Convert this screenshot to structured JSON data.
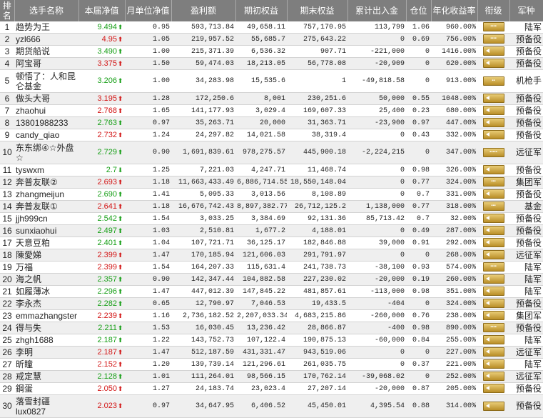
{
  "headers": [
    "排名",
    "选手名称",
    "本届净值",
    "月单位净值",
    "盈利额",
    "期初权益",
    "期末权益",
    "累计出入金",
    "仓位",
    "年化收益率",
    "衔级",
    "军种"
  ],
  "colors": {
    "header_bg": "#7e7e7e",
    "up": "#19a019",
    "down": "#d31818",
    "badge_gold": "#c99e33"
  },
  "rows": [
    {
      "rank": "1",
      "name": "趋势为王",
      "nav": "9.494",
      "dir": "up",
      "arrow": "⬆",
      "month": "0.95",
      "profit": "593,713.84",
      "start": "49,658.11",
      "end": "757,170.95",
      "flow": "113,799",
      "pos": "1.06",
      "annual": "960.00%",
      "badge": "▪▪▪▪",
      "type": "陆军"
    },
    {
      "rank": "2",
      "name": "yzl666",
      "nav": "4.95",
      "dir": "down",
      "arrow": "⬆",
      "month": "1.05",
      "profit": "219,957.52",
      "start": "55,685.7",
      "end": "275,643.22",
      "flow": "0",
      "pos": "0.69",
      "annual": "756.00%",
      "badge": "▪▪▪▪",
      "type": "预备役"
    },
    {
      "rank": "3",
      "name": "期货船说",
      "nav": "3.490",
      "dir": "up",
      "arrow": "⬆",
      "month": "1.00",
      "profit": "215,371.39",
      "start": "6,536.32",
      "end": "907.71",
      "flow": "-221,000",
      "pos": "0",
      "annual": "1416.00%",
      "badge": "",
      "type": "预备役"
    },
    {
      "rank": "4",
      "name": "阿宝哥",
      "nav": "3.375",
      "dir": "down",
      "arrow": "⬆",
      "month": "1.50",
      "profit": "59,474.03",
      "start": "18,213.05",
      "end": "56,778.08",
      "flow": "-20,909",
      "pos": "0",
      "annual": "620.00%",
      "badge": "",
      "type": "预备役"
    },
    {
      "rank": "5",
      "name": "顿悟了：人和昆仑基金",
      "nav": "3.206",
      "dir": "up",
      "arrow": "⬆",
      "month": "1.00",
      "profit": "34,283.98",
      "start": "15,535.6",
      "end": "1",
      "flow": "-49,818.58",
      "pos": "0",
      "annual": "913.00%",
      "badge": "▪▪",
      "type": "机枪手",
      "tall": true
    },
    {
      "rank": "6",
      "name": "做头大哥",
      "nav": "3.195",
      "dir": "down",
      "arrow": "⬆",
      "month": "1.28",
      "profit": "172,250.6",
      "start": "8,001",
      "end": "230,251.6",
      "flow": "50,000",
      "pos": "0.55",
      "annual": "1048.00%",
      "badge": "",
      "type": "预备役"
    },
    {
      "rank": "7",
      "name": "zhaohui",
      "nav": "2.768",
      "dir": "down",
      "arrow": "⬆",
      "month": "1.65",
      "profit": "141,177.93",
      "start": "3,029.4",
      "end": "169,607.33",
      "flow": "25,400",
      "pos": "0.23",
      "annual": "680.00%",
      "badge": "",
      "type": "预备役"
    },
    {
      "rank": "8",
      "name": "13801988233",
      "nav": "2.763",
      "dir": "up",
      "arrow": "⬆",
      "month": "0.97",
      "profit": "35,263.71",
      "start": "20,000",
      "end": "31,363.71",
      "flow": "-23,900",
      "pos": "0.97",
      "annual": "447.00%",
      "badge": "",
      "type": "预备役"
    },
    {
      "rank": "9",
      "name": "candy_qiao",
      "nav": "2.732",
      "dir": "down",
      "arrow": "⬆",
      "month": "1.24",
      "profit": "24,297.82",
      "start": "14,021.58",
      "end": "38,319.4",
      "flow": "0",
      "pos": "0.43",
      "annual": "332.00%",
      "badge": "",
      "type": "预备役"
    },
    {
      "rank": "10",
      "name": "东东绑④☆外盘☆",
      "nav": "2.729",
      "dir": "up",
      "arrow": "⬆",
      "month": "0.90",
      "profit": "1,691,839.61",
      "start": "978,275.57",
      "end": "445,900.18",
      "flow": "-2,224,215",
      "pos": "0",
      "annual": "347.00%",
      "badge": "▪▪▪▪▪",
      "type": "远征军",
      "tall": true
    },
    {
      "rank": "11",
      "name": "tyswxm",
      "nav": "2.7",
      "dir": "up",
      "arrow": "⬇",
      "month": "1.25",
      "profit": "7,221.03",
      "start": "4,247.71",
      "end": "11,468.74",
      "flow": "0",
      "pos": "0.98",
      "annual": "326.00%",
      "badge": "",
      "type": "预备役"
    },
    {
      "rank": "12",
      "name": "奔普友联②",
      "nav": "2.693",
      "dir": "down",
      "arrow": "⬆",
      "month": "1.18",
      "profit": "11,663,433.49",
      "start": "6,886,714.55",
      "end": "18,550,148.04",
      "flow": "0",
      "pos": "0.77",
      "annual": "324.00%",
      "badge": "▪▪▪",
      "type": "集团军"
    },
    {
      "rank": "13",
      "name": "zhangmeijun",
      "nav": "2.690",
      "dir": "up",
      "arrow": "⬆",
      "month": "1.41",
      "profit": "5,095.33",
      "start": "3,013.56",
      "end": "8,108.89",
      "flow": "0",
      "pos": "0.7",
      "annual": "331.00%",
      "badge": "",
      "type": "预备役"
    },
    {
      "rank": "14",
      "name": "奔普友联①",
      "nav": "2.641",
      "dir": "down",
      "arrow": "⬆",
      "month": "1.18",
      "profit": "16,676,742.43",
      "start": "8,897,382.77",
      "end": "26,712,125.2",
      "flow": "1,138,000",
      "pos": "0.77",
      "annual": "318.00%",
      "badge": "▪▪▪",
      "type": "基金"
    },
    {
      "rank": "15",
      "name": "jjh999cn",
      "nav": "2.542",
      "dir": "up",
      "arrow": "⬆",
      "month": "1.54",
      "profit": "3,033.25",
      "start": "3,384.69",
      "end": "92,131.36",
      "flow": "85,713.42",
      "pos": "0.7",
      "annual": "32.00%",
      "badge": "",
      "type": "预备役"
    },
    {
      "rank": "16",
      "name": "sunxiaohui",
      "nav": "2.497",
      "dir": "up",
      "arrow": "⬆",
      "month": "1.03",
      "profit": "2,510.81",
      "start": "1,677.2",
      "end": "4,188.01",
      "flow": "0",
      "pos": "0.49",
      "annual": "287.00%",
      "badge": "",
      "type": "预备役"
    },
    {
      "rank": "17",
      "name": "天意豆粕",
      "nav": "2.401",
      "dir": "up",
      "arrow": "⬆",
      "month": "1.04",
      "profit": "107,721.71",
      "start": "36,125.17",
      "end": "182,846.88",
      "flow": "39,000",
      "pos": "0.91",
      "annual": "292.00%",
      "badge": "",
      "type": "预备役"
    },
    {
      "rank": "18",
      "name": "陳愛娣",
      "nav": "2.399",
      "dir": "down",
      "arrow": "⬆",
      "month": "1.47",
      "profit": "170,185.94",
      "start": "121,606.03",
      "end": "291,791.97",
      "flow": "0",
      "pos": "0",
      "annual": "268.00%",
      "badge": "",
      "type": "远征军"
    },
    {
      "rank": "19",
      "name": "万福",
      "nav": "2.399",
      "dir": "down",
      "arrow": "⬆",
      "month": "1.54",
      "profit": "164,207.33",
      "start": "115,631.4",
      "end": "241,738.73",
      "flow": "-38,100",
      "pos": "0.93",
      "annual": "574.00%",
      "badge": "▪▪▪▪",
      "type": "陆军"
    },
    {
      "rank": "20",
      "name": "海之帆",
      "nav": "2.357",
      "dir": "up",
      "arrow": "⬆",
      "month": "0.90",
      "profit": "142,347.44",
      "start": "104,882.58",
      "end": "227,230.02",
      "flow": "-20,000",
      "pos": "0.19",
      "annual": "260.00%",
      "badge": "",
      "type": "陆军"
    },
    {
      "rank": "21",
      "name": "如履薄冰",
      "nav": "2.296",
      "dir": "up",
      "arrow": "⬆",
      "month": "1.47",
      "profit": "447,012.39",
      "start": "147,845.22",
      "end": "481,857.61",
      "flow": "-113,000",
      "pos": "0.98",
      "annual": "351.00%",
      "badge": "",
      "type": "陆军"
    },
    {
      "rank": "22",
      "name": "李永杰",
      "nav": "2.282",
      "dir": "up",
      "arrow": "⬆",
      "month": "0.65",
      "profit": "12,790.97",
      "start": "7,046.53",
      "end": "19,433.5",
      "flow": "-404",
      "pos": "0",
      "annual": "324.00%",
      "badge": "",
      "type": "预备役"
    },
    {
      "rank": "23",
      "name": "emmazhangster",
      "nav": "2.239",
      "dir": "down",
      "arrow": "⬆",
      "month": "1.16",
      "profit": "2,736,182.52",
      "start": "2,207,033.34",
      "end": "4,683,215.86",
      "flow": "-260,000",
      "pos": "0.76",
      "annual": "238.00%",
      "badge": "",
      "type": "集团军"
    },
    {
      "rank": "24",
      "name": "得与失",
      "nav": "2.211",
      "dir": "up",
      "arrow": "⬆",
      "month": "1.53",
      "profit": "16,030.45",
      "start": "13,236.42",
      "end": "28,866.87",
      "flow": "-400",
      "pos": "0.98",
      "annual": "890.00%",
      "badge": "▪▪▪▪",
      "type": "预备役"
    },
    {
      "rank": "25",
      "name": "zhgh1688",
      "nav": "2.187",
      "dir": "up",
      "arrow": "⬆",
      "month": "1.22",
      "profit": "143,752.73",
      "start": "107,122.4",
      "end": "190,875.13",
      "flow": "-60,000",
      "pos": "0.84",
      "annual": "255.00%",
      "badge": "",
      "type": "陆军"
    },
    {
      "rank": "26",
      "name": "李明",
      "nav": "2.187",
      "dir": "down",
      "arrow": "⬆",
      "month": "1.47",
      "profit": "512,187.59",
      "start": "431,331.47",
      "end": "943,519.06",
      "flow": "0",
      "pos": "0",
      "annual": "227.00%",
      "badge": "",
      "type": "远征军"
    },
    {
      "rank": "27",
      "name": "昕瞳",
      "nav": "2.152",
      "dir": "down",
      "arrow": "⬆",
      "month": "1.20",
      "profit": "139,739.14",
      "start": "121,296.61",
      "end": "261,035.75",
      "flow": "0",
      "pos": "0.37",
      "annual": "221.00%",
      "badge": "",
      "type": "陆军"
    },
    {
      "rank": "28",
      "name": "戒定慧",
      "nav": "2.128",
      "dir": "up",
      "arrow": "⬆",
      "month": "1.01",
      "profit": "111,264.01",
      "start": "98,566.15",
      "end": "170,762.14",
      "flow": "-39,068.02",
      "pos": "0",
      "annual": "252.00%",
      "badge": "",
      "type": "远征军"
    },
    {
      "rank": "29",
      "name": "鋼蛋",
      "nav": "2.050",
      "dir": "down",
      "arrow": "⬆",
      "month": "1.27",
      "profit": "24,183.74",
      "start": "23,023.4",
      "end": "27,207.14",
      "flow": "-20,000",
      "pos": "0.87",
      "annual": "205.00%",
      "badge": "",
      "type": "预备役"
    },
    {
      "rank": "30",
      "name": "落雪封疆 lux0827",
      "nav": "2.023",
      "dir": "down",
      "arrow": "⬆",
      "month": "0.97",
      "profit": "34,647.95",
      "start": "6,406.52",
      "end": "45,450.01",
      "flow": "4,395.54",
      "pos": "0.88",
      "annual": "314.00%",
      "badge": "",
      "type": "预备役",
      "tall": true
    }
  ]
}
